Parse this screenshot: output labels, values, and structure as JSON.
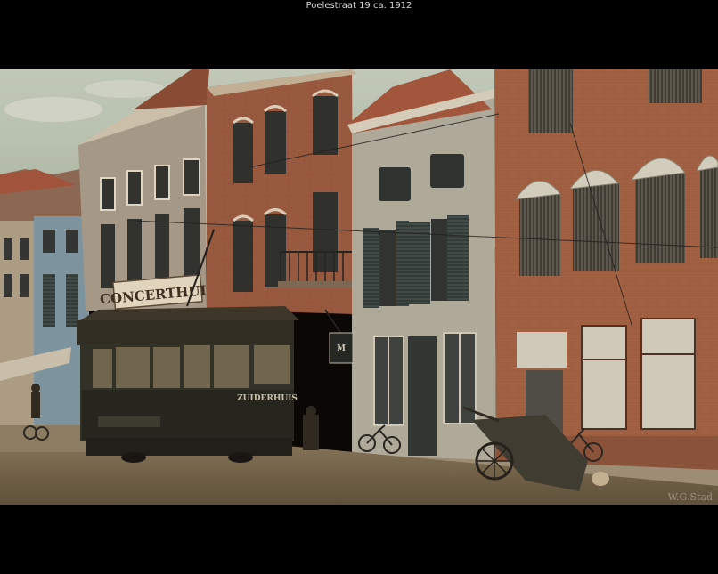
{
  "caption": "Poelestraat 19 ca. 1912",
  "photo": {
    "shop_sign": "CONCERTHUIS",
    "hanging_sign": "M",
    "tram_destination": "ZUIDERHUIS",
    "watermark": "W.G.Stad"
  },
  "colors": {
    "background": "#000000",
    "sky": "#b9c7bd",
    "brick": "#9a5a3f",
    "street": "#8a7a60"
  }
}
